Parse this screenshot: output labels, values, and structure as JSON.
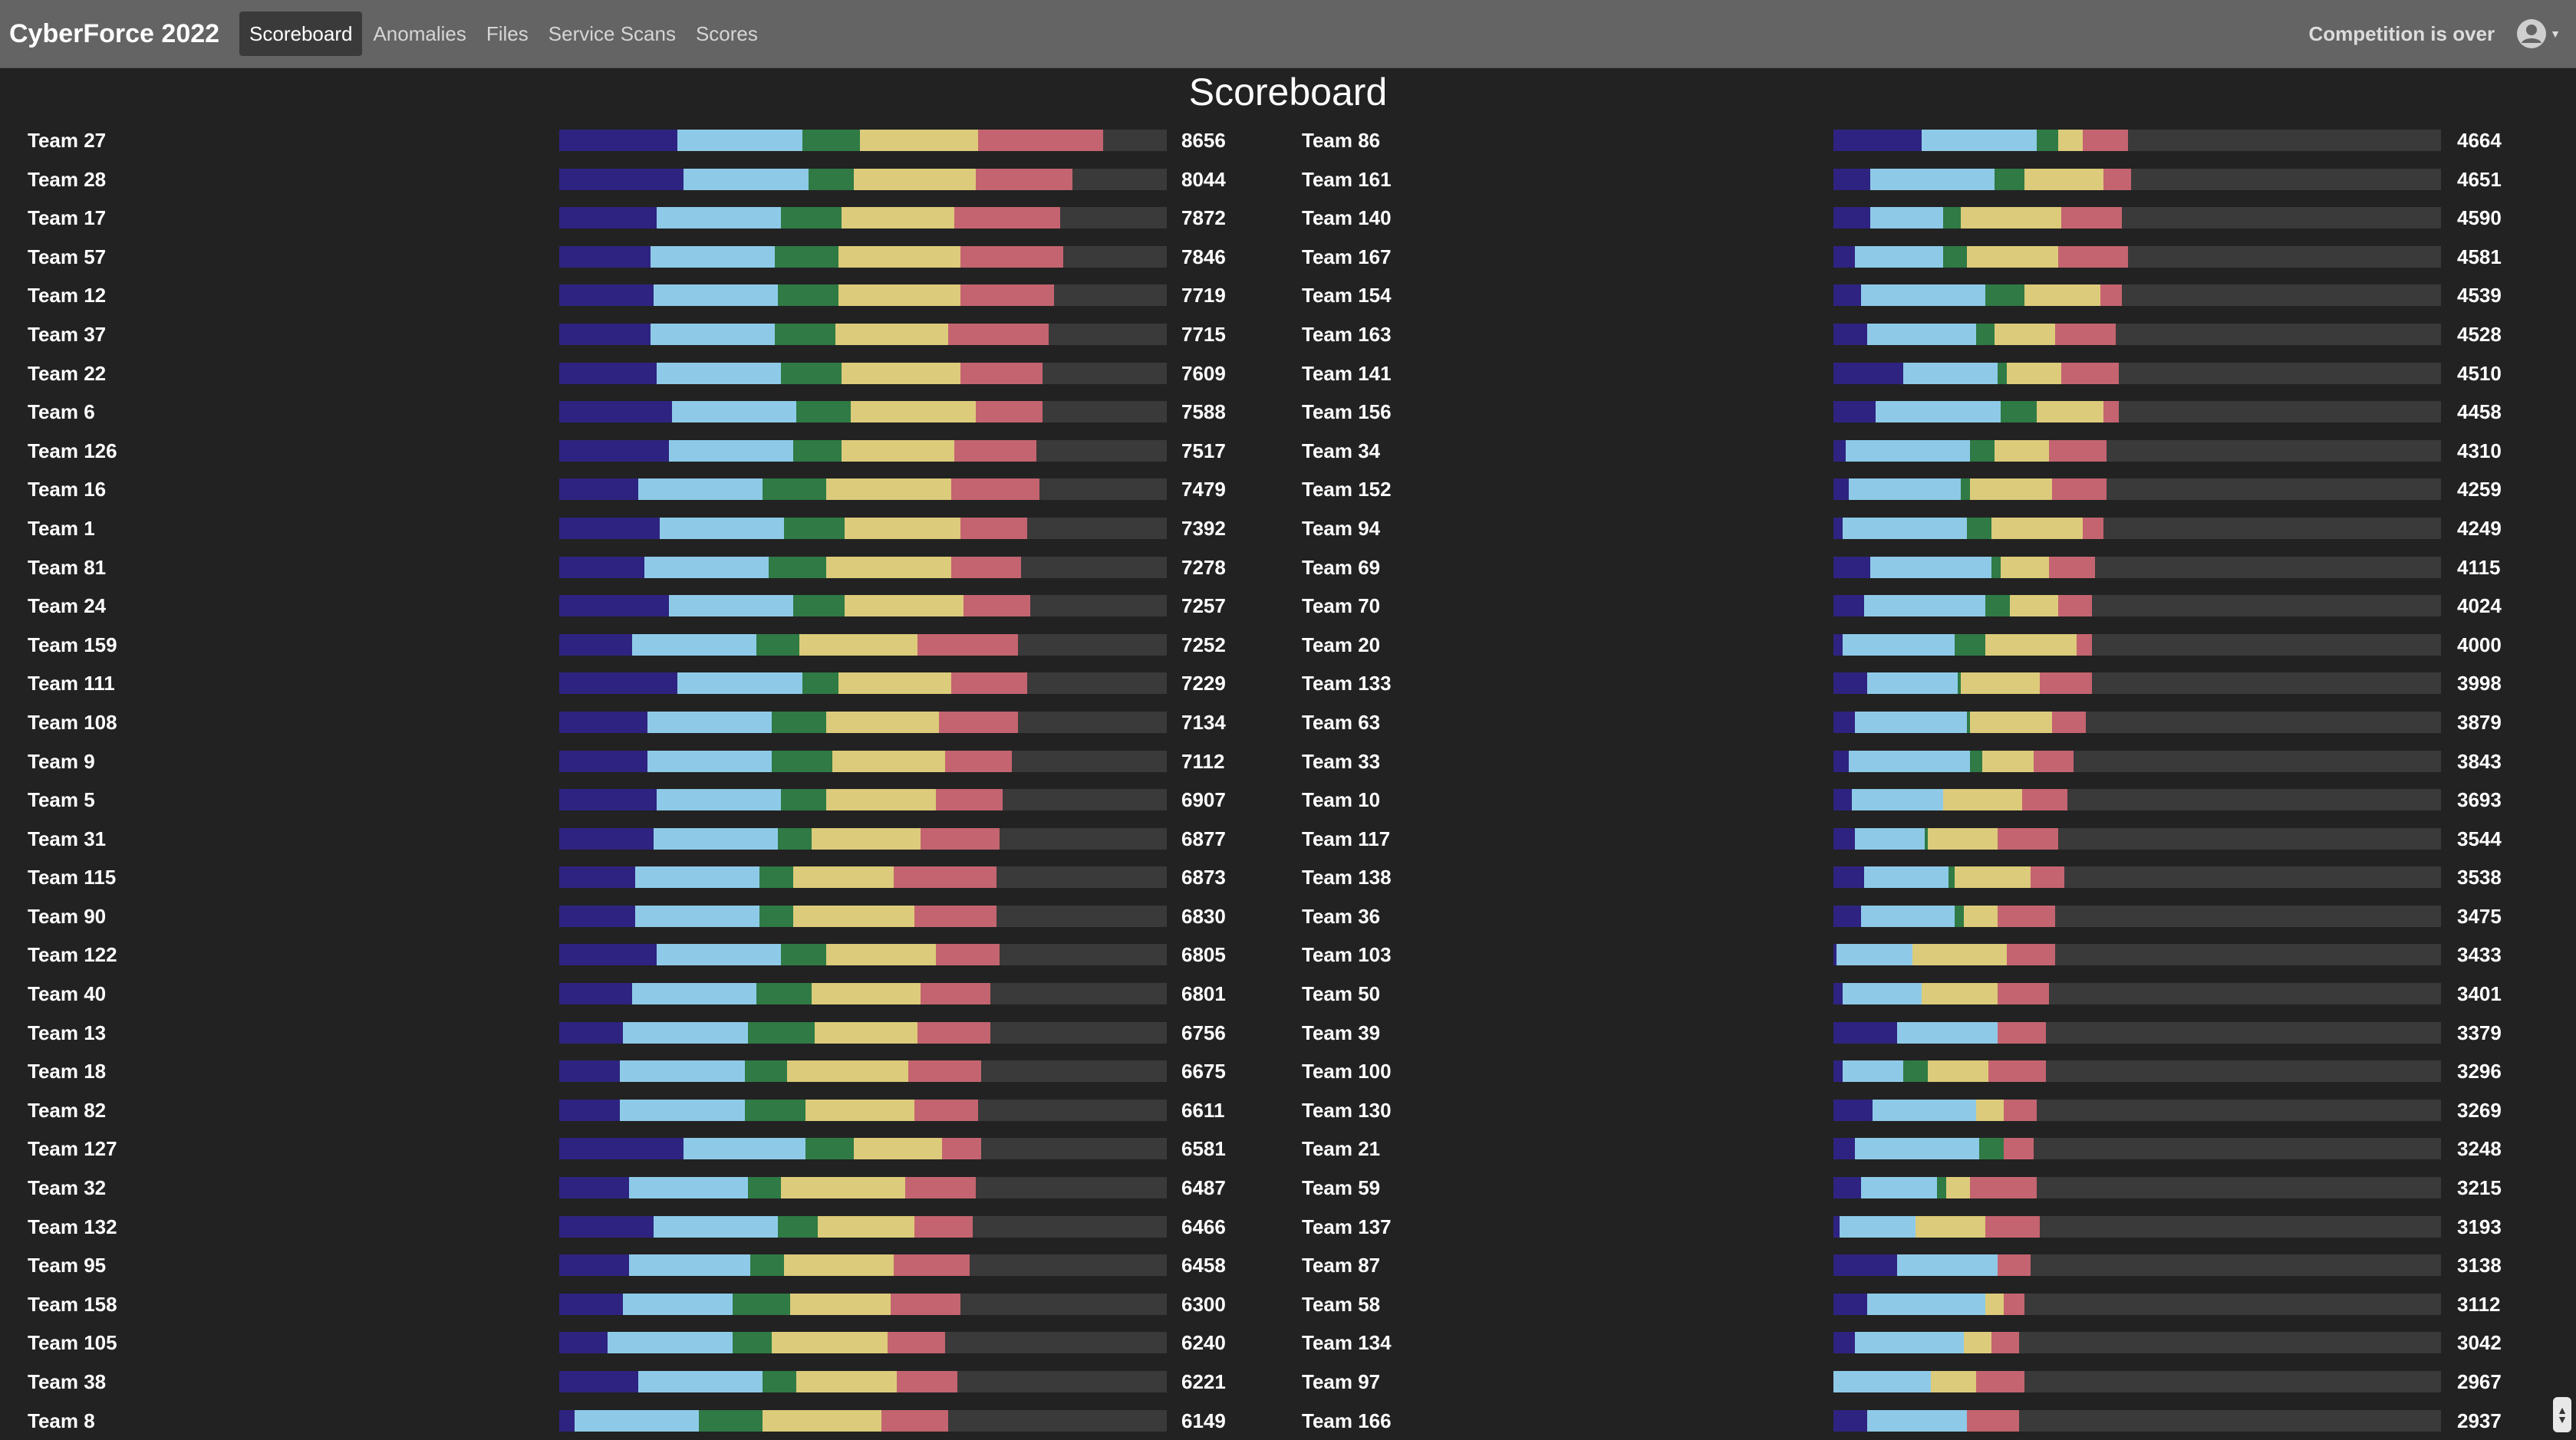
{
  "navbar": {
    "brand": "CyberForce 2022",
    "items": [
      {
        "label": "Scoreboard",
        "active": true
      },
      {
        "label": "Anomalies",
        "active": false
      },
      {
        "label": "Files",
        "active": false
      },
      {
        "label": "Service Scans",
        "active": false
      },
      {
        "label": "Scores",
        "active": false
      }
    ],
    "status": "Competition is over",
    "user_icon": "user-circle-icon"
  },
  "page_title": "Scoreboard",
  "colors": {
    "segments": [
      "#2e2380",
      "#8ecae8",
      "#2f7a45",
      "#dccb7a",
      "#c46470"
    ],
    "bar_track": "#3a3a3a",
    "background": "#222222",
    "navbar": "#646464"
  },
  "chart_data": {
    "type": "bar",
    "max_score": 10000,
    "left": [
      {
        "team": "Team 27",
        "score": "8656",
        "parts": [
          1950,
          2050,
          950,
          1950,
          2050
        ]
      },
      {
        "team": "Team 28",
        "score": "8044",
        "parts": [
          2050,
          2050,
          750,
          2000,
          1600
        ]
      },
      {
        "team": "Team 17",
        "score": "7872",
        "parts": [
          1600,
          2050,
          1000,
          1850,
          1750
        ]
      },
      {
        "team": "Team 57",
        "score": "7846",
        "parts": [
          1500,
          2050,
          1050,
          2000,
          1700
        ]
      },
      {
        "team": "Team 12",
        "score": "7719",
        "parts": [
          1550,
          2050,
          1000,
          2000,
          1550
        ]
      },
      {
        "team": "Team 37",
        "score": "7715",
        "parts": [
          1500,
          2050,
          1000,
          1850,
          1650
        ]
      },
      {
        "team": "Team 22",
        "score": "7609",
        "parts": [
          1600,
          2050,
          1000,
          1950,
          1350
        ]
      },
      {
        "team": "Team 6",
        "score": "7588",
        "parts": [
          1850,
          2050,
          900,
          2050,
          1100
        ]
      },
      {
        "team": "Team 126",
        "score": "7517",
        "parts": [
          1800,
          2050,
          800,
          1850,
          1350
        ]
      },
      {
        "team": "Team 16",
        "score": "7479",
        "parts": [
          1300,
          2050,
          1050,
          2050,
          1450
        ]
      },
      {
        "team": "Team 1",
        "score": "7392",
        "parts": [
          1650,
          2050,
          1000,
          1900,
          1100
        ]
      },
      {
        "team": "Team 81",
        "score": "7278",
        "parts": [
          1400,
          2050,
          950,
          2050,
          1150
        ]
      },
      {
        "team": "Team 24",
        "score": "7257",
        "parts": [
          1800,
          2050,
          850,
          1950,
          1100
        ]
      },
      {
        "team": "Team 159",
        "score": "7252",
        "parts": [
          1200,
          2050,
          700,
          1950,
          1650
        ]
      },
      {
        "team": "Team 111",
        "score": "7229",
        "parts": [
          1950,
          2050,
          600,
          1850,
          1250
        ]
      },
      {
        "team": "Team 108",
        "score": "7134",
        "parts": [
          1450,
          2050,
          900,
          1850,
          1300
        ]
      },
      {
        "team": "Team 9",
        "score": "7112",
        "parts": [
          1450,
          2050,
          1000,
          1850,
          1100
        ]
      },
      {
        "team": "Team 5",
        "score": "6907",
        "parts": [
          1600,
          2050,
          750,
          1800,
          1100
        ]
      },
      {
        "team": "Team 31",
        "score": "6877",
        "parts": [
          1550,
          2050,
          550,
          1800,
          1300
        ]
      },
      {
        "team": "Team 115",
        "score": "6873",
        "parts": [
          1250,
          2050,
          550,
          1650,
          1700
        ]
      },
      {
        "team": "Team 90",
        "score": "6830",
        "parts": [
          1250,
          2050,
          550,
          2000,
          1350
        ]
      },
      {
        "team": "Team 122",
        "score": "6805",
        "parts": [
          1600,
          2050,
          750,
          1800,
          1050
        ]
      },
      {
        "team": "Team 40",
        "score": "6801",
        "parts": [
          1200,
          2050,
          900,
          1800,
          1150
        ]
      },
      {
        "team": "Team 13",
        "score": "6756",
        "parts": [
          1050,
          2050,
          1100,
          1700,
          1200
        ]
      },
      {
        "team": "Team 18",
        "score": "6675",
        "parts": [
          1000,
          2050,
          700,
          2000,
          1200
        ]
      },
      {
        "team": "Team 82",
        "score": "6611",
        "parts": [
          1000,
          2050,
          1000,
          1800,
          1050
        ]
      },
      {
        "team": "Team 127",
        "score": "6581",
        "parts": [
          2050,
          2000,
          800,
          1450,
          650
        ]
      },
      {
        "team": "Team 32",
        "score": "6487",
        "parts": [
          1150,
          1950,
          550,
          2050,
          1150
        ]
      },
      {
        "team": "Team 132",
        "score": "6466",
        "parts": [
          1550,
          2050,
          650,
          1600,
          950
        ]
      },
      {
        "team": "Team 95",
        "score": "6458",
        "parts": [
          1150,
          2000,
          550,
          1800,
          1250
        ]
      },
      {
        "team": "Team 158",
        "score": "6300",
        "parts": [
          1050,
          1800,
          950,
          1650,
          1150
        ]
      },
      {
        "team": "Team 105",
        "score": "6240",
        "parts": [
          800,
          2050,
          650,
          1900,
          950
        ]
      },
      {
        "team": "Team 38",
        "score": "6221",
        "parts": [
          1300,
          2050,
          550,
          1650,
          1000
        ]
      },
      {
        "team": "Team 8",
        "score": "6149",
        "parts": [
          250,
          2050,
          1050,
          1950,
          1100
        ]
      }
    ],
    "right": [
      {
        "team": "Team 86",
        "score": "4664",
        "parts": [
          1450,
          1900,
          350,
          400,
          750
        ]
      },
      {
        "team": "Team 161",
        "score": "4651",
        "parts": [
          600,
          2050,
          500,
          1300,
          450
        ]
      },
      {
        "team": "Team 140",
        "score": "4590",
        "parts": [
          600,
          1200,
          300,
          1650,
          1000
        ]
      },
      {
        "team": "Team 167",
        "score": "4581",
        "parts": [
          350,
          1450,
          400,
          1500,
          1150
        ]
      },
      {
        "team": "Team 154",
        "score": "4539",
        "parts": [
          450,
          2050,
          650,
          1250,
          350
        ]
      },
      {
        "team": "Team 163",
        "score": "4528",
        "parts": [
          550,
          1800,
          300,
          1000,
          1000
        ]
      },
      {
        "team": "Team 141",
        "score": "4510",
        "parts": [
          1150,
          1550,
          150,
          900,
          950
        ]
      },
      {
        "team": "Team 156",
        "score": "4458",
        "parts": [
          700,
          2050,
          600,
          1100,
          250
        ]
      },
      {
        "team": "Team 34",
        "score": "4310",
        "parts": [
          200,
          2050,
          400,
          900,
          950
        ]
      },
      {
        "team": "Team 152",
        "score": "4259",
        "parts": [
          250,
          1850,
          150,
          1350,
          900
        ]
      },
      {
        "team": "Team 94",
        "score": "4249",
        "parts": [
          150,
          2050,
          400,
          1500,
          350
        ]
      },
      {
        "team": "Team 69",
        "score": "4115",
        "parts": [
          600,
          2000,
          150,
          800,
          750
        ]
      },
      {
        "team": "Team 70",
        "score": "4024",
        "parts": [
          500,
          2000,
          400,
          800,
          550
        ]
      },
      {
        "team": "Team 20",
        "score": "4000",
        "parts": [
          150,
          1850,
          500,
          1500,
          250
        ]
      },
      {
        "team": "Team 133",
        "score": "3998",
        "parts": [
          550,
          1500,
          50,
          1300,
          850
        ]
      },
      {
        "team": "Team 63",
        "score": "3879",
        "parts": [
          350,
          1850,
          50,
          1350,
          550
        ]
      },
      {
        "team": "Team 33",
        "score": "3843",
        "parts": [
          250,
          2000,
          200,
          850,
          650
        ]
      },
      {
        "team": "Team 10",
        "score": "3693",
        "parts": [
          300,
          1500,
          0,
          1300,
          750
        ]
      },
      {
        "team": "Team 117",
        "score": "3544",
        "parts": [
          350,
          1150,
          50,
          1150,
          1000
        ]
      },
      {
        "team": "Team 138",
        "score": "3538",
        "parts": [
          500,
          1400,
          100,
          1250,
          550
        ]
      },
      {
        "team": "Team 36",
        "score": "3475",
        "parts": [
          450,
          1550,
          150,
          550,
          950
        ]
      },
      {
        "team": "Team 103",
        "score": "3433",
        "parts": [
          50,
          1250,
          0,
          1550,
          800
        ]
      },
      {
        "team": "Team 50",
        "score": "3401",
        "parts": [
          150,
          1300,
          0,
          1250,
          850
        ]
      },
      {
        "team": "Team 39",
        "score": "3379",
        "parts": [
          1050,
          1650,
          0,
          0,
          800
        ]
      },
      {
        "team": "Team 100",
        "score": "3296",
        "parts": [
          150,
          1000,
          400,
          1000,
          950
        ]
      },
      {
        "team": "Team 130",
        "score": "3269",
        "parts": [
          650,
          1700,
          0,
          450,
          550
        ]
      },
      {
        "team": "Team 21",
        "score": "3248",
        "parts": [
          350,
          2050,
          400,
          0,
          500
        ]
      },
      {
        "team": "Team 59",
        "score": "3215",
        "parts": [
          450,
          1250,
          150,
          400,
          1100
        ]
      },
      {
        "team": "Team 137",
        "score": "3193",
        "parts": [
          100,
          1250,
          0,
          1150,
          900
        ]
      },
      {
        "team": "Team 87",
        "score": "3138",
        "parts": [
          1050,
          1650,
          0,
          0,
          550
        ]
      },
      {
        "team": "Team 58",
        "score": "3112",
        "parts": [
          550,
          1950,
          0,
          300,
          350
        ]
      },
      {
        "team": "Team 134",
        "score": "3042",
        "parts": [
          350,
          1800,
          0,
          450,
          450
        ]
      },
      {
        "team": "Team 97",
        "score": "2967",
        "parts": [
          0,
          1600,
          0,
          750,
          800
        ]
      },
      {
        "team": "Team 166",
        "score": "2937",
        "parts": [
          550,
          1650,
          0,
          0,
          850
        ]
      }
    ]
  }
}
